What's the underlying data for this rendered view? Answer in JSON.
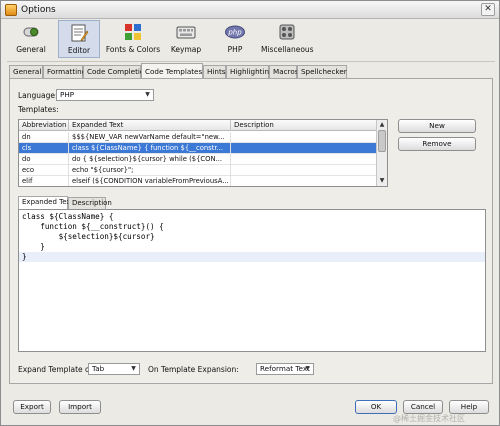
{
  "window": {
    "title": "Options",
    "close_glyph": "✕"
  },
  "categories": [
    {
      "label": "General",
      "icon": "switch-icon"
    },
    {
      "label": "Editor",
      "icon": "editor-icon"
    },
    {
      "label": "Fonts & Colors",
      "icon": "palette-icon"
    },
    {
      "label": "Keymap",
      "icon": "keyboard-icon"
    },
    {
      "label": "PHP",
      "icon": "php-icon"
    },
    {
      "label": "Miscellaneous",
      "icon": "puzzle-icon"
    }
  ],
  "selected_category": "Editor",
  "tabs": [
    "General",
    "Formatting",
    "Code Completion",
    "Code Templates",
    "Hints",
    "Highlighting",
    "Macros",
    "Spellchecker"
  ],
  "active_tab": "Code Templates",
  "language": {
    "label": "Language:",
    "value": "PHP"
  },
  "templates_label": "Templates:",
  "table": {
    "columns": [
      "Abbreviation",
      "Expanded Text",
      "Description"
    ],
    "rows": [
      {
        "abbr": "dn",
        "text": "$$${NEW_VAR newVarName default=\"new...",
        "desc": ""
      },
      {
        "abbr": "cls",
        "text": "class ${ClassName} {    function ${__constr...",
        "desc": ""
      },
      {
        "abbr": "do",
        "text": "do {    ${selection}${cursor} while (${CON...",
        "desc": ""
      },
      {
        "abbr": "eco",
        "text": "echo \"${cursor}\";",
        "desc": ""
      },
      {
        "abbr": "elif",
        "text": "elseif (${CONDITION variableFromPreviousA...",
        "desc": ""
      }
    ],
    "selected_row": 1
  },
  "buttons": {
    "new": "New",
    "remove": "Remove",
    "export": "Export",
    "import": "Import",
    "ok": "OK",
    "cancel": "Cancel",
    "help": "Help"
  },
  "inner_tabs": [
    "Expanded Text",
    "Description"
  ],
  "active_inner_tab": "Expanded Text",
  "editor_lines": [
    "class ${ClassName} {",
    "    function ${__construct}() {",
    "        ${selection}${cursor}",
    "    }",
    "}"
  ],
  "expand_on": {
    "label": "Expand Template on:",
    "value": "Tab"
  },
  "on_expansion": {
    "label": "On Template Expansion:",
    "value": "Reformat Text"
  },
  "watermark": "@稀土掘金技术社区"
}
